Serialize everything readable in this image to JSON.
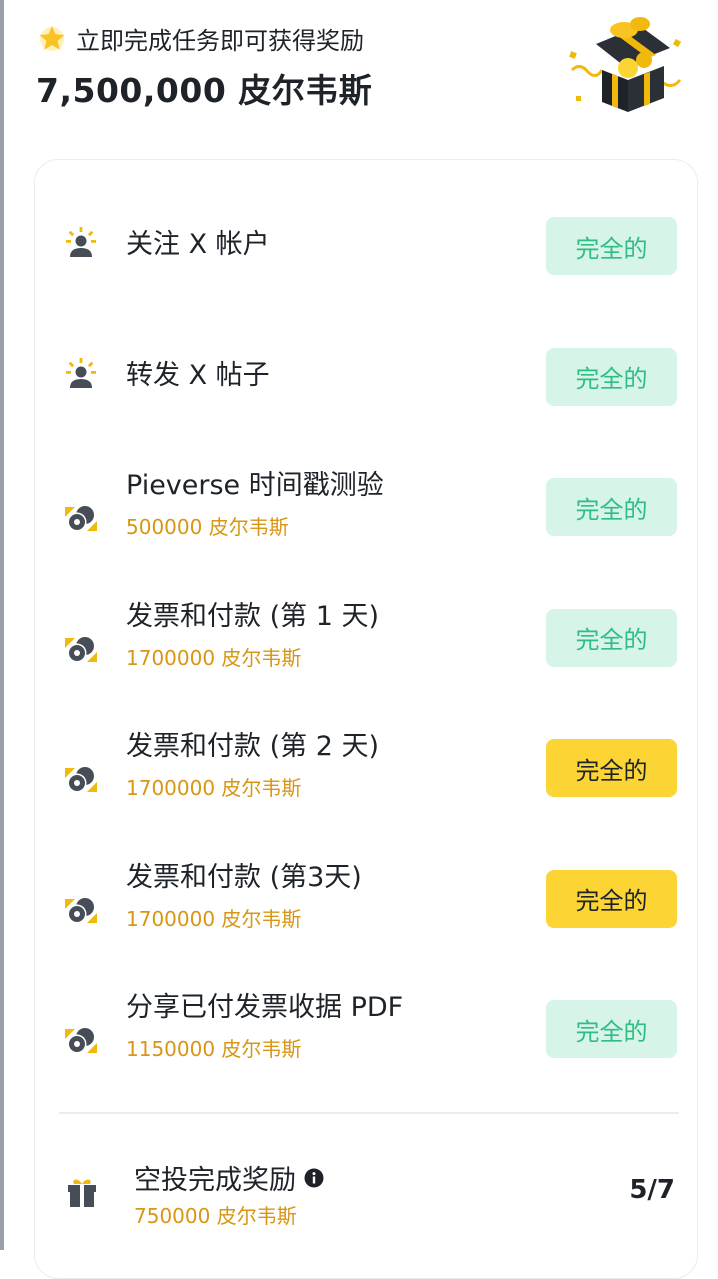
{
  "header": {
    "subtitle": "立即完成任务即可获得奖励",
    "total": "7,500,000 皮尔韦斯"
  },
  "tasks": [
    {
      "title": "关注 X 帐户",
      "reward": "",
      "icon": "user-badge-icon",
      "status": "完全的",
      "state": "done"
    },
    {
      "title": "转发 X 帖子",
      "reward": "",
      "icon": "user-badge-icon",
      "status": "完全的",
      "state": "done"
    },
    {
      "title": "Pieverse 时间戳测验",
      "reward": "500000 皮尔韦斯",
      "icon": "coin-ticket-icon",
      "status": "完全的",
      "state": "done"
    },
    {
      "title": "发票和付款 (第 1 天)",
      "reward": "1700000 皮尔韦斯",
      "icon": "coin-ticket-icon",
      "status": "完全的",
      "state": "done"
    },
    {
      "title": "发票和付款 (第 2 天)",
      "reward": "1700000 皮尔韦斯",
      "icon": "coin-ticket-icon",
      "status": "完全的",
      "state": "todo"
    },
    {
      "title": "发票和付款 (第3天)",
      "reward": "1700000 皮尔韦斯",
      "icon": "coin-ticket-icon",
      "status": "完全的",
      "state": "todo"
    },
    {
      "title": "分享已付发票收据 PDF",
      "reward": "1150000 皮尔韦斯",
      "icon": "coin-ticket-icon",
      "status": "完全的",
      "state": "done"
    }
  ],
  "bonus": {
    "title": "空投完成奖励",
    "reward": "750000 皮尔韦斯",
    "progress": "5/7",
    "icon": "gift-icon"
  },
  "colors": {
    "accent_yellow": "#fcd535",
    "done_bg": "#d7f4e8",
    "done_text": "#2ebd85",
    "reward_text": "#d89614"
  }
}
